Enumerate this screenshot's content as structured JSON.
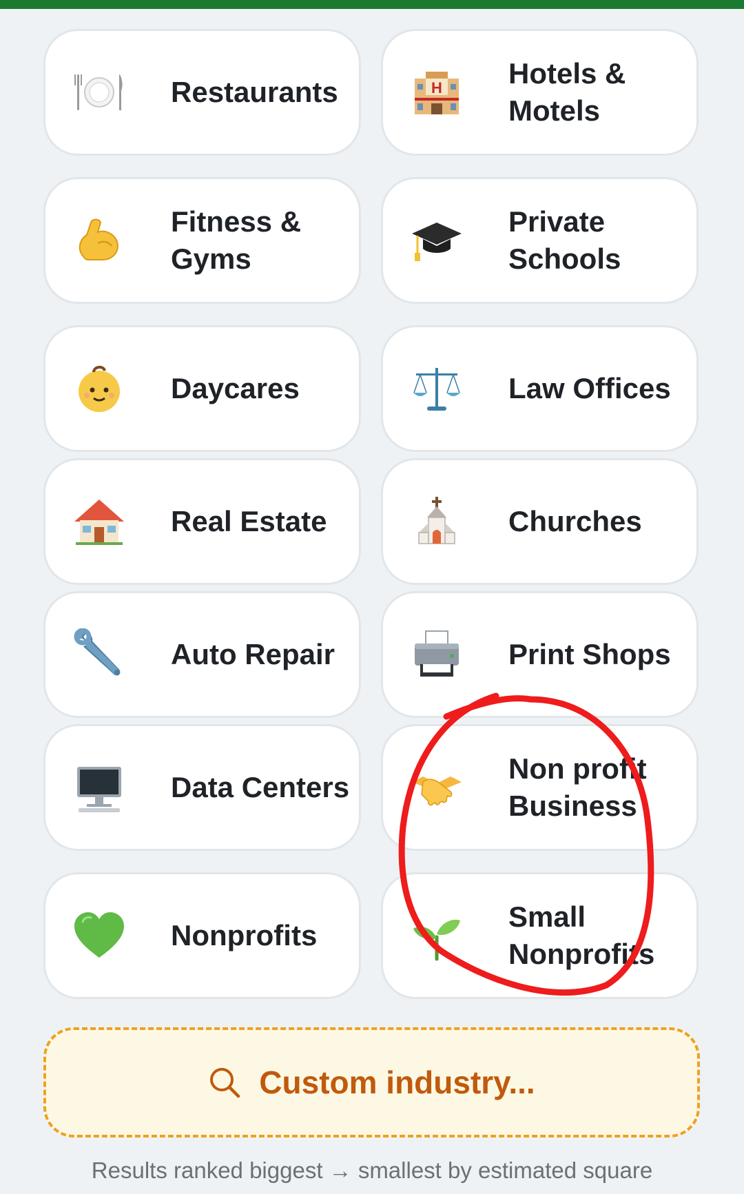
{
  "colors": {
    "topbar": "#1b7a30",
    "background": "#eef2f5",
    "card_background": "#ffffff",
    "card_border": "#e1e6ea",
    "text": "#1f2328",
    "custom_border": "#f0a020",
    "custom_background": "#fdf8e4",
    "custom_text": "#c05a0d",
    "annotation": "#ee1c1c"
  },
  "industries": [
    {
      "label": "Restaurants",
      "icon": "fork-knife-plate-icon"
    },
    {
      "label": "Hotels &\nMotels",
      "icon": "hotel-icon"
    },
    {
      "label": "Fitness &\nGyms",
      "icon": "flexed-biceps-icon"
    },
    {
      "label": "Private\nSchools",
      "icon": "graduation-cap-icon"
    },
    {
      "label": "Daycares",
      "icon": "baby-icon"
    },
    {
      "label": "Law Offices",
      "icon": "balance-scale-icon"
    },
    {
      "label": "Real Estate",
      "icon": "house-icon"
    },
    {
      "label": "Churches",
      "icon": "church-icon"
    },
    {
      "label": "Auto Repair",
      "icon": "wrench-icon"
    },
    {
      "label": "Print Shops",
      "icon": "printer-icon"
    },
    {
      "label": "Data Centers",
      "icon": "desktop-computer-icon"
    },
    {
      "label": "Non profit\nBusiness",
      "icon": "handshake-icon"
    },
    {
      "label": "Nonprofits",
      "icon": "green-heart-icon"
    },
    {
      "label": "Small\nNonprofits",
      "icon": "seedling-icon"
    }
  ],
  "custom": {
    "label": "Custom industry...",
    "icon": "search-icon"
  },
  "footer": {
    "text": "Results ranked biggest → smallest by estimated square"
  }
}
